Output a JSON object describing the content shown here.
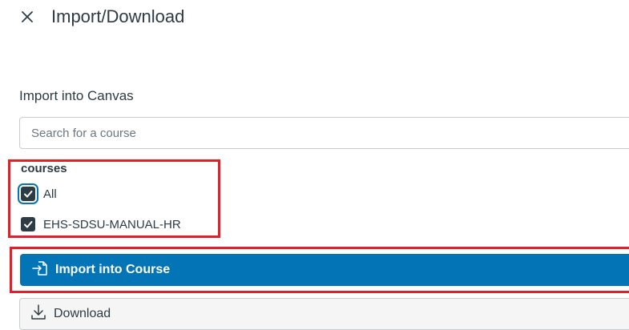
{
  "header": {
    "close_icon": "close-icon",
    "title": "Import/Download"
  },
  "import_section": {
    "label": "Import into Canvas",
    "search_placeholder": "Search for a course"
  },
  "courses": {
    "label": "courses",
    "options": [
      {
        "label": "All",
        "checked": true
      },
      {
        "label": "EHS-SDSU-MANUAL-HR",
        "checked": true
      }
    ]
  },
  "actions": {
    "import_label": "Import into Course",
    "import_icon": "import-icon",
    "download_label": "Download",
    "download_icon": "download-icon"
  },
  "colors": {
    "primary": "#0374b5",
    "text": "#2d3b45",
    "highlight": "#e0202a",
    "border": "#c7cdd1"
  }
}
